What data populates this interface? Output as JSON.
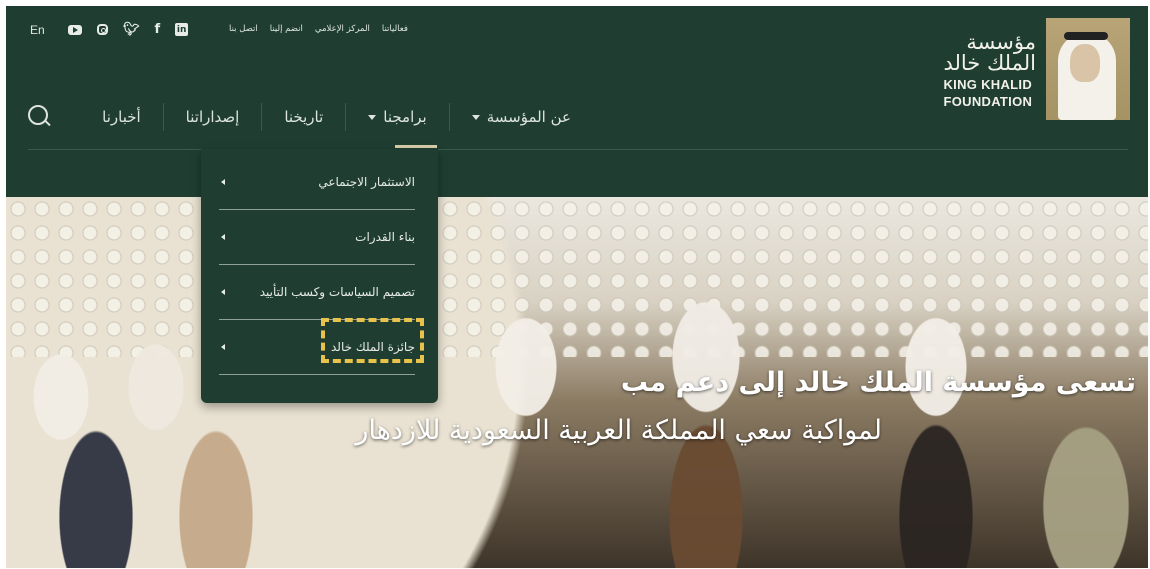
{
  "header": {
    "lang_toggle": "En",
    "social_icons": [
      "youtube-icon",
      "instagram-icon",
      "twitter-icon",
      "facebook-icon",
      "linkedin-icon"
    ],
    "top_links": [
      "فعالياتنا",
      "المركز الإعلامي",
      "انضم إلينا",
      "اتصل بنا"
    ],
    "nav": [
      {
        "label": "عن المؤسسة",
        "has_caret": true
      },
      {
        "label": "برامجنا",
        "has_caret": true,
        "active": true
      },
      {
        "label": "تاريخنا",
        "has_caret": false
      },
      {
        "label": "إصداراتنا",
        "has_caret": false
      },
      {
        "label": "أخبارنا",
        "has_caret": false
      }
    ],
    "logo": {
      "ar_line1": "مؤسسة",
      "ar_line2": "الملك خالد",
      "en_line1": "KING KHALID",
      "en_line2": "FOUNDATION"
    }
  },
  "dropdown": {
    "items": [
      "الاستثمار الاجتماعي",
      "بناء القدرات",
      "تصميم السياسات وكسب التأييد",
      "جائزة الملك خالد"
    ]
  },
  "hero": {
    "title": "تسعى مؤسسة الملك خالد إلى دعم مب",
    "subtitle": "لمواكبة سعي المملكة العربية السعودية للازدهار"
  },
  "colors": {
    "header_bg": "#1f3e31",
    "accent": "#d7cfa9",
    "highlight": "#e8c24a"
  }
}
